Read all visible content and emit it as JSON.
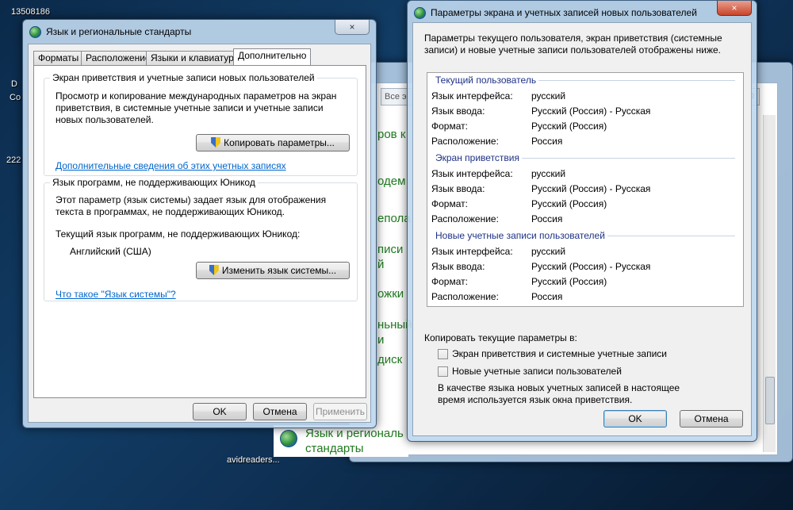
{
  "desktop": {
    "top_label": "13508186",
    "left_label_1": "D",
    "left_label_2": "Co",
    "left_label_3": "222",
    "bottom_label": "avidreaders..."
  },
  "bg_window": {
    "search_placeholder": "Все э",
    "items": [
      "ров к",
      "одем",
      "епола",
      "писи",
      "й",
      "ожки",
      "ньный",
      "и",
      "диск"
    ],
    "footer_line1": "Язык и региональ",
    "footer_line2": "стандарты"
  },
  "left_dialog": {
    "title": "Язык и региональные стандарты",
    "tabs": [
      "Форматы",
      "Расположение",
      "Языки и клавиатуры",
      "Дополнительно"
    ],
    "group1": {
      "label": "Экран приветствия и учетные записи новых пользователей",
      "desc": "Просмотр и копирование международных параметров на экран приветствия, в системные учетные записи и учетные записи новых пользователей.",
      "button": "Копировать параметры...",
      "link": "Дополнительные сведения об этих учетных записях"
    },
    "group2": {
      "label": "Язык программ, не поддерживающих Юникод",
      "desc": "Этот параметр (язык системы) задает язык для отображения текста в программах, не поддерживающих Юникод.",
      "current_label": "Текущий язык программ, не поддерживающих Юникод:",
      "current_value": "Английский (США)",
      "button": "Изменить язык системы...",
      "link": "Что такое \"Язык системы\"?"
    },
    "ok": "OK",
    "cancel": "Отмена",
    "apply": "Применить"
  },
  "right_dialog": {
    "title": "Параметры экрана и учетных записей новых пользователей",
    "header": "Параметры текущего пользователя, экран приветствия (системные записи) и новые учетные записи пользователей отображены ниже.",
    "sections": [
      {
        "title": "Текущий пользователь",
        "rows": [
          {
            "k": "Язык интерфейса:",
            "v": "русский"
          },
          {
            "k": "Язык ввода:",
            "v": "Русский (Россия) - Русская"
          },
          {
            "k": "Формат:",
            "v": "Русский (Россия)"
          },
          {
            "k": "Расположение:",
            "v": "Россия"
          }
        ]
      },
      {
        "title": "Экран приветствия",
        "rows": [
          {
            "k": "Язык интерфейса:",
            "v": "русский"
          },
          {
            "k": "Язык ввода:",
            "v": "Русский (Россия) - Русская"
          },
          {
            "k": "Формат:",
            "v": "Русский (Россия)"
          },
          {
            "k": "Расположение:",
            "v": "Россия"
          }
        ]
      },
      {
        "title": "Новые учетные записи пользователей",
        "rows": [
          {
            "k": "Язык интерфейса:",
            "v": "русский"
          },
          {
            "k": "Язык ввода:",
            "v": "Русский (Россия) - Русская"
          },
          {
            "k": "Формат:",
            "v": "Русский (Россия)"
          },
          {
            "k": "Расположение:",
            "v": "Россия"
          }
        ]
      }
    ],
    "copy_label": "Копировать текущие параметры в:",
    "checkbox1": "Экран приветствия и системные учетные записи",
    "checkbox2": "Новые учетные записи пользователей",
    "note": "В качестве языка новых учетных записей в настоящее время используется язык окна приветствия.",
    "ok": "OK",
    "cancel": "Отмена"
  },
  "icons": {
    "close": "×",
    "search": "⚲"
  }
}
